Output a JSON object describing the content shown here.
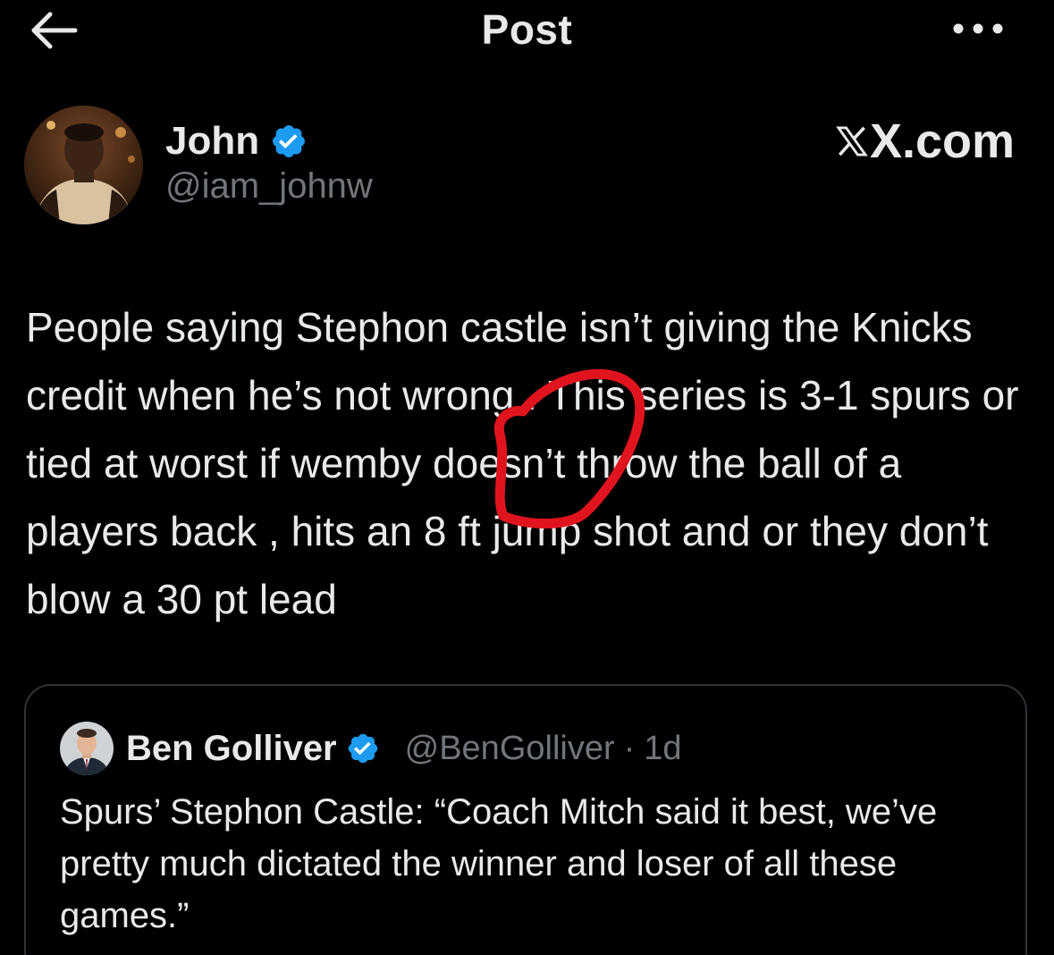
{
  "header": {
    "title": "Post",
    "back_icon": "arrow-left-icon",
    "more_icon": "more-horizontal-icon"
  },
  "post": {
    "author_name": "John",
    "author_handle": "@iam_johnw",
    "verified": true,
    "brand": "X.com",
    "text": "People saying Stephon castle isn’t giving the Knicks credit when he’s not wrong . This series is 3-1 spurs or tied at worst if wemby doesn’t throw the ball of a players back , hits an 8 ft jump shot and or they don’t blow a 30 pt lead",
    "annotation_color": "#e0141e"
  },
  "quote": {
    "author_name": "Ben Golliver",
    "author_handle": "@BenGolliver",
    "separator": "·",
    "time": "1d",
    "verified": true,
    "text": "Spurs’ Stephon Castle: “Coach Mitch said it best, we’ve pretty much dictated the winner and loser of all these games.”"
  },
  "colors": {
    "background": "#000000",
    "text_primary": "#e7e9ea",
    "text_secondary": "#71767b",
    "verified_blue": "#1d9bf0",
    "card_border": "#2f3336"
  }
}
